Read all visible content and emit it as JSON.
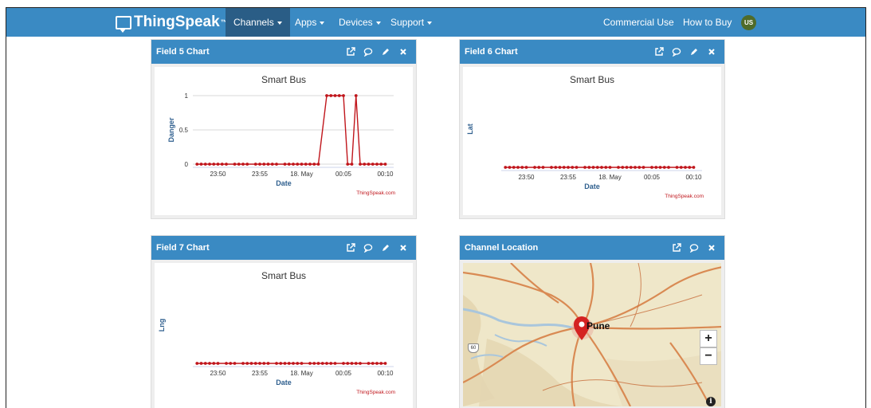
{
  "navbar": {
    "brand": "ThingSpeak",
    "trademark": "™",
    "items": [
      {
        "label": "Channels",
        "active": true
      },
      {
        "label": "Apps"
      },
      {
        "label": "Devices"
      },
      {
        "label": "Support"
      }
    ],
    "right_links": [
      "Commercial Use",
      "How to Buy"
    ],
    "avatar_initials": "US"
  },
  "panels": {
    "field5": {
      "title": "Field 5 Chart"
    },
    "field6": {
      "title": "Field 6 Chart"
    },
    "field7": {
      "title": "Field 7 Chart"
    },
    "location": {
      "title": "Channel Location"
    }
  },
  "map": {
    "city": "Pune",
    "highway_shield": "60",
    "zoom_in": "+",
    "zoom_out": "−",
    "info": "i",
    "colors": {
      "land": "#efe7c9",
      "roads": "#d98a53",
      "water": "#a9c6dc",
      "marker": "#d42222"
    }
  },
  "colors": {
    "header": "#3a8ac3",
    "active_nav": "#2a5d86",
    "series": "#c0161c",
    "axis_text": "#333333",
    "axis_title": "#2f5f8e",
    "credits": "#c0161c"
  },
  "icons": [
    "external-link-icon",
    "comment-icon",
    "pencil-icon",
    "close-icon"
  ],
  "chart_data": [
    {
      "type": "line",
      "title": "Smart Bus",
      "xlabel": "Date",
      "ylabel": "Danger",
      "credits": "ThingSpeak.com",
      "x_ticks": [
        "23:50",
        "23:55",
        "18. May",
        "00:05",
        "00:10"
      ],
      "y_ticks": [
        "0",
        "0.5",
        "1"
      ],
      "ylim": [
        0,
        1
      ],
      "x_range": [
        "2019-05-17 23:47",
        "2019-05-18 00:11"
      ],
      "grid": true,
      "series": [
        {
          "x": [
            "23:47:30",
            "23:48",
            "23:48:30",
            "23:49",
            "23:49:30",
            "23:50",
            "23:50:30",
            "23:51",
            "23:52",
            "23:52:30",
            "23:53",
            "23:53:30",
            "23:54:30",
            "23:55",
            "23:55:30",
            "23:56",
            "23:56:30",
            "23:57",
            "23:58",
            "23:58:30",
            "23:59",
            "23:59:30",
            "00:00",
            "00:00:30",
            "00:01",
            "00:01:30",
            "00:02",
            "00:03",
            "00:03:30",
            "00:04",
            "00:04:30",
            "00:05",
            "00:05:30",
            "00:06",
            "00:06:30",
            "00:07",
            "00:07:30",
            "00:08",
            "00:08:30",
            "00:09",
            "00:09:30",
            "00:10"
          ],
          "y": [
            0,
            0,
            0,
            0,
            0,
            0,
            0,
            0,
            0,
            0,
            0,
            0,
            0,
            0,
            0,
            0,
            0,
            0,
            0,
            0,
            0,
            0,
            0,
            0,
            0,
            0,
            0,
            1,
            1,
            1,
            1,
            1,
            0,
            0,
            1,
            0,
            0,
            0,
            0,
            0,
            0,
            0
          ]
        }
      ]
    },
    {
      "type": "line",
      "title": "Smart Bus",
      "xlabel": "Date",
      "ylabel": "Lat",
      "credits": "ThingSpeak.com",
      "x_ticks": [
        "23:50",
        "23:55",
        "18. May",
        "00:05",
        "00:10"
      ],
      "y_ticks": [],
      "x_range": [
        "2019-05-17 23:47",
        "2019-05-18 00:11"
      ],
      "series": [
        {
          "x": [
            "23:47:30",
            "23:48",
            "23:48:30",
            "23:49",
            "23:49:30",
            "23:50",
            "23:51",
            "23:51:30",
            "23:52",
            "23:53",
            "23:53:30",
            "23:54",
            "23:54:30",
            "23:55",
            "23:55:30",
            "23:56",
            "23:57",
            "23:57:30",
            "23:58",
            "23:58:30",
            "23:59",
            "23:59:30",
            "00:00",
            "00:01",
            "00:01:30",
            "00:02",
            "00:02:30",
            "00:03",
            "00:03:30",
            "00:04",
            "00:05",
            "00:05:30",
            "00:06",
            "00:06:30",
            "00:07",
            "00:08",
            "00:08:30",
            "00:09",
            "00:09:30",
            "00:10"
          ],
          "y": [
            0,
            0,
            0,
            0,
            0,
            0,
            0,
            0,
            0,
            0,
            0,
            0,
            0,
            0,
            0,
            0,
            0,
            0,
            0,
            0,
            0,
            0,
            0,
            0,
            0,
            0,
            0,
            0,
            0,
            0,
            0,
            0,
            0,
            0,
            0,
            0,
            0,
            0,
            0,
            0
          ]
        }
      ]
    },
    {
      "type": "line",
      "title": "Smart Bus",
      "xlabel": "Date",
      "ylabel": "Lng",
      "credits": "ThingSpeak.com",
      "x_ticks": [
        "23:50",
        "23:55",
        "18. May",
        "00:05",
        "00:10"
      ],
      "y_ticks": [],
      "x_range": [
        "2019-05-17 23:47",
        "2019-05-18 00:11"
      ],
      "series": [
        {
          "x": [
            "23:47:30",
            "23:48",
            "23:48:30",
            "23:49",
            "23:49:30",
            "23:50",
            "23:51",
            "23:51:30",
            "23:52",
            "23:53",
            "23:53:30",
            "23:54",
            "23:54:30",
            "23:55",
            "23:55:30",
            "23:56",
            "23:57",
            "23:57:30",
            "23:58",
            "23:58:30",
            "23:59",
            "23:59:30",
            "00:00",
            "00:01",
            "00:01:30",
            "00:02",
            "00:02:30",
            "00:03",
            "00:03:30",
            "00:04",
            "00:05",
            "00:05:30",
            "00:06",
            "00:06:30",
            "00:07",
            "00:08",
            "00:08:30",
            "00:09",
            "00:09:30",
            "00:10"
          ],
          "y": [
            0,
            0,
            0,
            0,
            0,
            0,
            0,
            0,
            0,
            0,
            0,
            0,
            0,
            0,
            0,
            0,
            0,
            0,
            0,
            0,
            0,
            0,
            0,
            0,
            0,
            0,
            0,
            0,
            0,
            0,
            0,
            0,
            0,
            0,
            0,
            0,
            0,
            0,
            0,
            0
          ]
        }
      ]
    }
  ]
}
